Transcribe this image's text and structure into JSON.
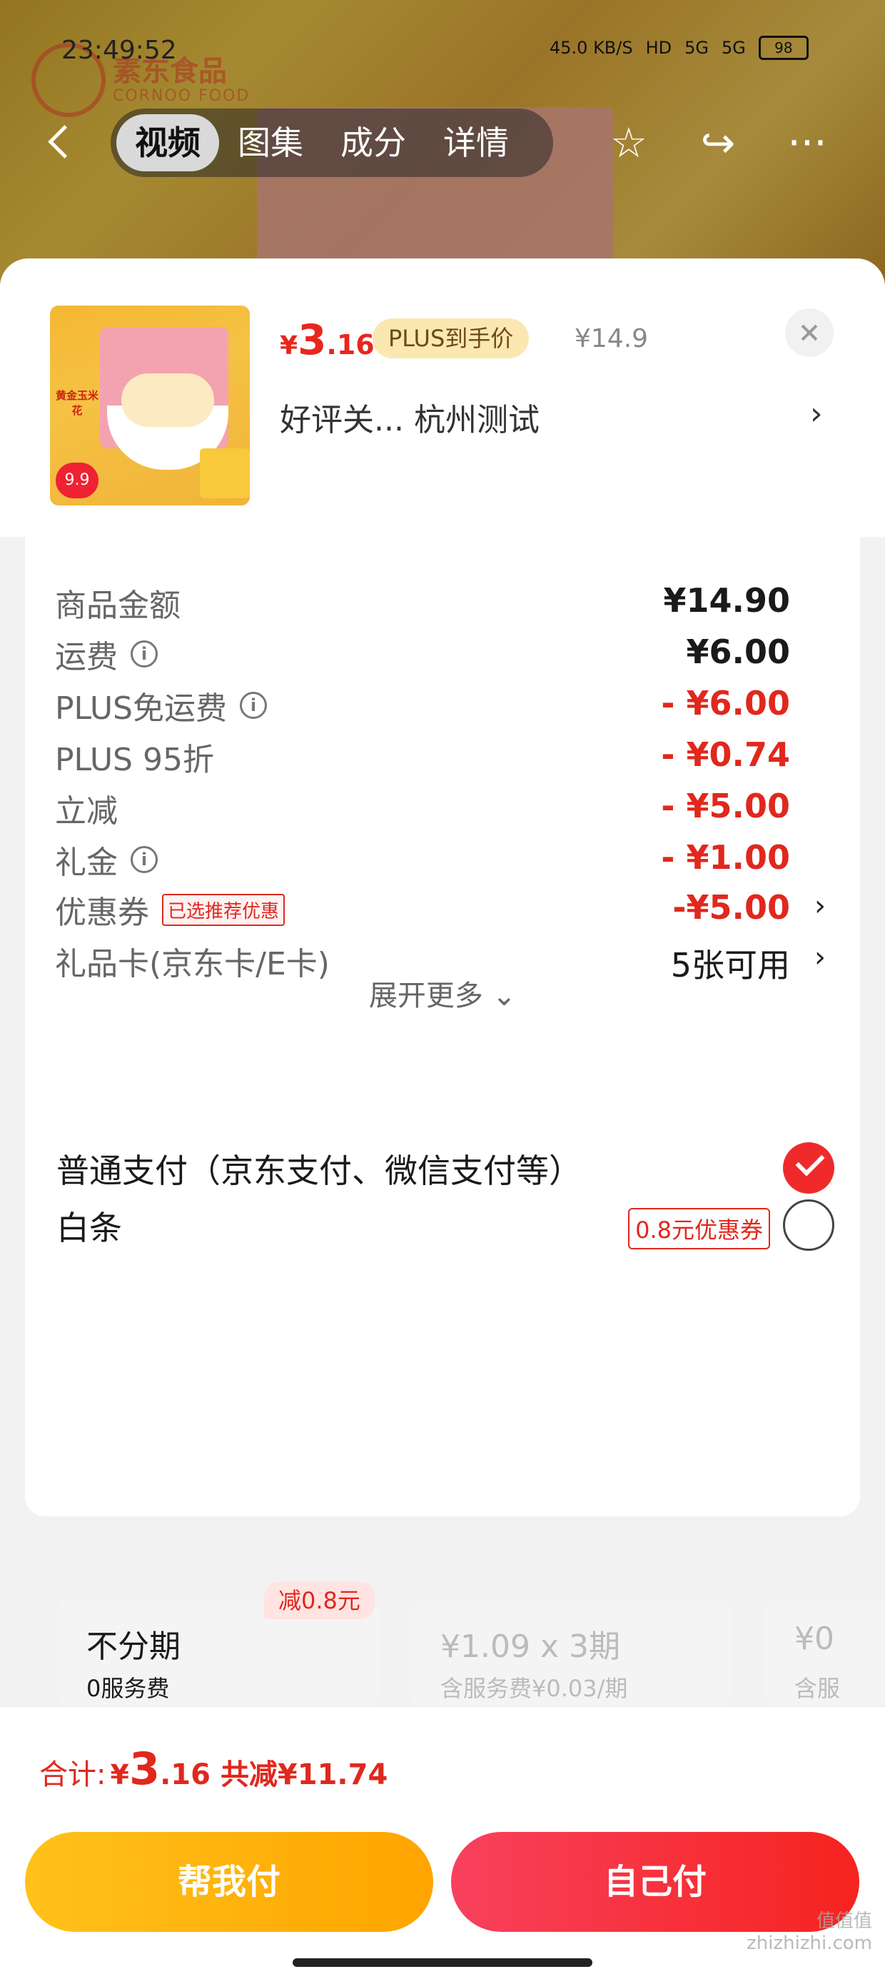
{
  "status_bar": {
    "time": "23:49:52",
    "net_speed": "45.0 KB/S",
    "hd": "HD",
    "sig1": "5G",
    "sig2": "5G",
    "battery": "98"
  },
  "background": {
    "brand_logo": "素东食品",
    "brand_sub": "CORNOO FOOD"
  },
  "nav": {
    "tabs": [
      "视频",
      "图集",
      "成分",
      "详情"
    ],
    "active_tab": 0
  },
  "product": {
    "price_symbol": "¥",
    "price_int": "3",
    "price_dec": ".16",
    "plus_tag": "PLUS到手价",
    "original_price": "¥14.9",
    "address": "好评关...  杭州测试",
    "thumb_text": "黄金玉米花",
    "thumb_price": "9.9"
  },
  "fees": [
    {
      "label": "商品金额",
      "value": "¥14.90",
      "red": false,
      "info": false
    },
    {
      "label": "运费",
      "value": "¥6.00",
      "red": false,
      "info": true
    },
    {
      "label": "PLUS免运费",
      "value": "- ¥6.00",
      "red": true,
      "info": true
    },
    {
      "label": "PLUS 95折",
      "value": "- ¥0.74",
      "red": true,
      "info": false
    },
    {
      "label": "立减",
      "value": "- ¥5.00",
      "red": true,
      "info": false
    },
    {
      "label": "礼金",
      "value": "- ¥1.00",
      "red": true,
      "info": true
    },
    {
      "label": "优惠券",
      "value": "-¥5.00",
      "red": true,
      "info": false,
      "tag": "已选推荐优惠",
      "chevron": true
    },
    {
      "label": "礼品卡(京东卡/E卡)",
      "value": "5张可用",
      "red": false,
      "info": false,
      "chevron": true
    }
  ],
  "expand_more": "展开更多",
  "payment": {
    "normal_label": "普通支付（京东支付、微信支付等）",
    "baitiao_label": "白条",
    "baitiao_coupon": "0.8元优惠券",
    "plans": [
      {
        "title": "不分期",
        "sub": "0服务费",
        "badge": "减0.8元",
        "muted": false
      },
      {
        "title": "¥1.09 x 3期",
        "sub": "含服务费¥0.03/期",
        "muted": true
      },
      {
        "title": "¥0",
        "sub": "含服",
        "muted": true
      }
    ]
  },
  "footer": {
    "total_label": "合计:",
    "total_symbol": "¥",
    "total_int": "3",
    "total_dec": ".16",
    "total_cut": "共减¥11.74",
    "help_pay": "帮我付",
    "self_pay": "自己付"
  },
  "watermark": "值值值\nzhizhizhi.com",
  "colors": {
    "accent_red": "#e0281e",
    "help_yellow": "#ffb000",
    "self_red": "#f6231f"
  }
}
